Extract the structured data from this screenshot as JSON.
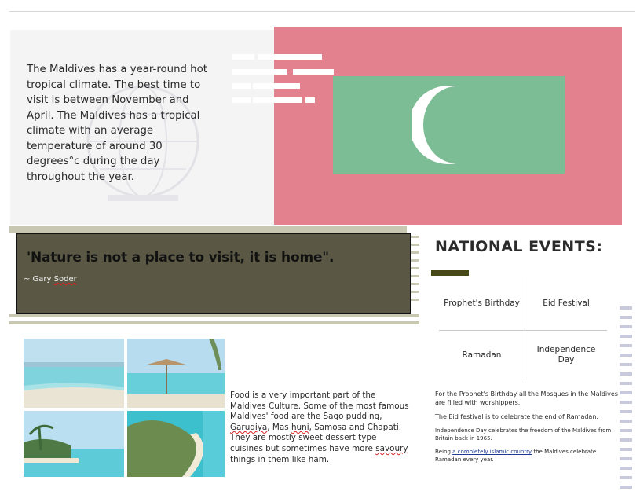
{
  "intro": {
    "text": "The Maldives has a year-round hot tropical climate. The best time to visit is between November and April. The Maldives has a tropical climate with an average temperature of around 30 degrees°c during the day throughout the year."
  },
  "quote": {
    "text": "'Nature is not a place to visit, it is home\".",
    "author_prefix": "~ Gary ",
    "author_name": "Soder"
  },
  "national_events": {
    "title": "NATIONAL EVENTS:",
    "cells": [
      "Prophet's Birthday",
      "Eid Festival",
      "Ramadan",
      "Independence Day"
    ],
    "notes": [
      "For the Prophet's Birthday all the Mosques in the Maldives are filled with worshippers.",
      "The Eid festival is to celebrate the end of Ramadan.",
      "Independence Day celebrates the freedom of the Maldives from Britain back in 1965."
    ],
    "islamic_note": {
      "prefix": "Being ",
      "link": "a completely islamic country",
      "suffix": " the Maldives celebrate Ramadan every year."
    }
  },
  "food": {
    "text_1": "Food is a very important part of the Maldives Culture. Some of the most famous Maldives' food are the Sago pudding, ",
    "word_1": "Garudiya",
    "text_2": ", Mas ",
    "word_2": "huni",
    "text_3": ", Samosa and Chapati. They are mostly sweet dessert type cuisines but sometimes have more ",
    "word_3": "savoury",
    "text_4": " things in them like ham."
  },
  "colors": {
    "flag_red": "#e4818f",
    "flag_green": "#7dbd96",
    "quote_box": "#5a5844",
    "accent": "#474a18"
  }
}
